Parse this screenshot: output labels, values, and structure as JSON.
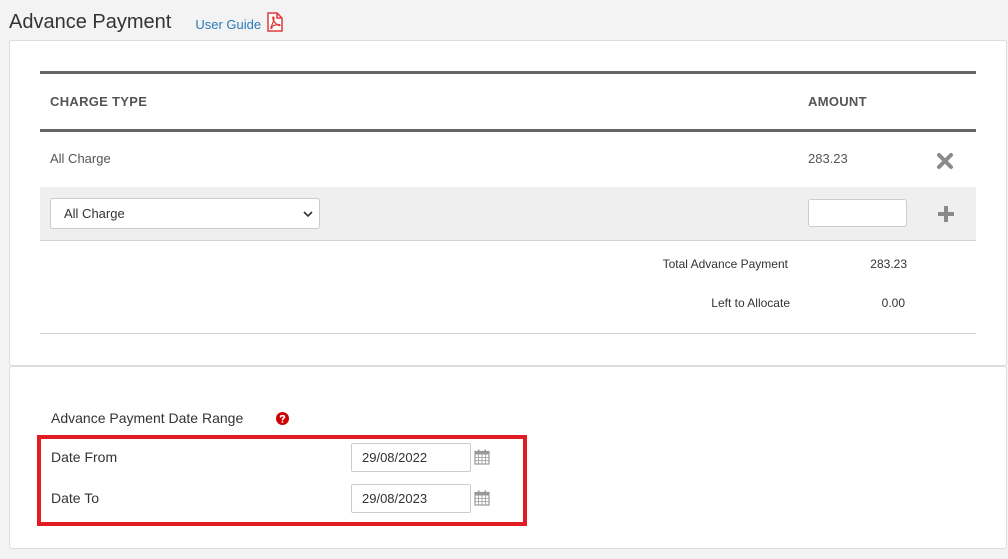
{
  "header": {
    "title": "Advance Payment",
    "user_guide_label": "User Guide",
    "pdf_icon": "pdf-icon"
  },
  "charges": {
    "columns": {
      "charge_type": "CHARGE TYPE",
      "amount": "AMOUNT"
    },
    "rows": [
      {
        "charge_type": "All Charge",
        "amount": "283.23",
        "remove_icon": "close-icon"
      }
    ],
    "add_row": {
      "selected_charge": "All Charge",
      "amount_value": "",
      "add_icon": "plus-icon"
    },
    "totals": {
      "total_label": "Total Advance Payment",
      "total_value": "283.23",
      "left_label": "Left to Allocate",
      "left_value": "0.00"
    }
  },
  "date_range": {
    "title": "Advance Payment Date Range",
    "help_icon": "question-circle-icon",
    "from_label": "Date From",
    "from_value": "29/08/2022",
    "to_label": "Date To",
    "to_value": "29/08/2023",
    "calendar_icon": "calendar-icon"
  },
  "colors": {
    "link": "#2a7ab8",
    "pdf": "#e03a3a",
    "highlight": "#e21b23",
    "help": "#cc0000",
    "icon_gray": "#8a8a8a"
  }
}
